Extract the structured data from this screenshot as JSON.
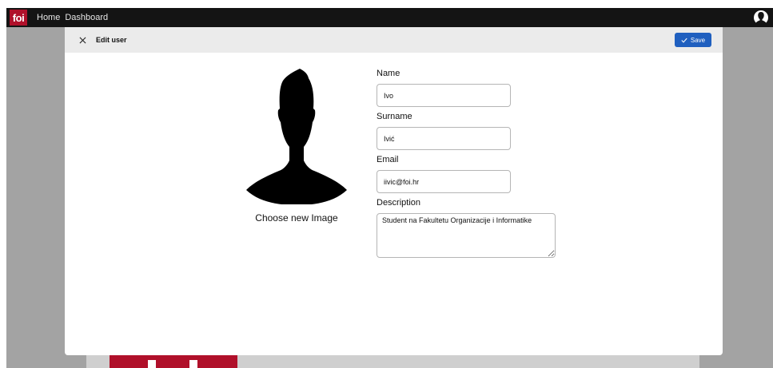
{
  "topbar": {
    "logo_text": "foi",
    "nav": [
      "Home",
      "Dashboard"
    ],
    "profile_icon": "user-silhouette-icon"
  },
  "modal": {
    "title": "Edit user",
    "close_icon": "close-icon",
    "save_label": "Save",
    "save_icon": "check-icon",
    "accent_color": "#1f5fbf",
    "choose_image_label": "Choose new Image",
    "fields": {
      "name": {
        "label": "Name",
        "value": "Ivo"
      },
      "surname": {
        "label": "Surname",
        "value": "Ivić"
      },
      "email": {
        "label": "Email",
        "value": "iivic@foi.hr"
      },
      "description": {
        "label": "Description",
        "value": "Student na Fakultetu Organizacije i Informatike"
      }
    }
  },
  "colors": {
    "brand_red": "#b0102a",
    "topbar_bg": "#141414",
    "backdrop": "#a3a3a3"
  }
}
